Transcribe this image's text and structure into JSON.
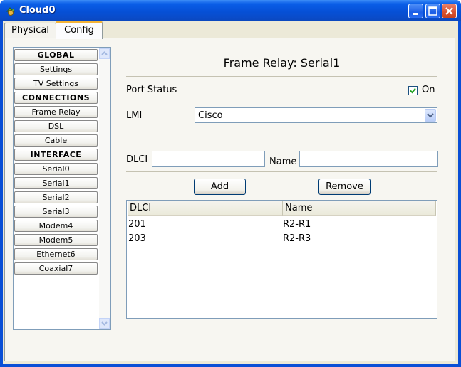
{
  "window": {
    "title": "Cloud0"
  },
  "tabs": [
    {
      "label": "Physical"
    },
    {
      "label": "Config"
    }
  ],
  "sidebar": {
    "items": [
      {
        "label": "GLOBAL"
      },
      {
        "label": "Settings"
      },
      {
        "label": "TV Settings"
      },
      {
        "label": "CONNECTIONS"
      },
      {
        "label": "Frame Relay"
      },
      {
        "label": "DSL"
      },
      {
        "label": "Cable"
      },
      {
        "label": "INTERFACE"
      },
      {
        "label": "Serial0"
      },
      {
        "label": "Serial1"
      },
      {
        "label": "Serial2"
      },
      {
        "label": "Serial3"
      },
      {
        "label": "Modem4"
      },
      {
        "label": "Modem5"
      },
      {
        "label": "Ethernet6"
      },
      {
        "label": "Coaxial7"
      }
    ]
  },
  "main": {
    "heading": "Frame Relay: Serial1",
    "port_status_label": "Port Status",
    "port_status_on_label": "On",
    "port_status_checked": true,
    "lmi_label": "LMI",
    "lmi_value": "Cisco",
    "dlci_label": "DLCI",
    "dlci_value": "",
    "name_label": "Name",
    "name_value": "",
    "add_button": "Add",
    "remove_button": "Remove",
    "table": {
      "columns": [
        "DLCI",
        "Name"
      ],
      "rows": [
        [
          "201",
          "R2-R1"
        ],
        [
          "203",
          "R2-R3"
        ]
      ]
    }
  }
}
